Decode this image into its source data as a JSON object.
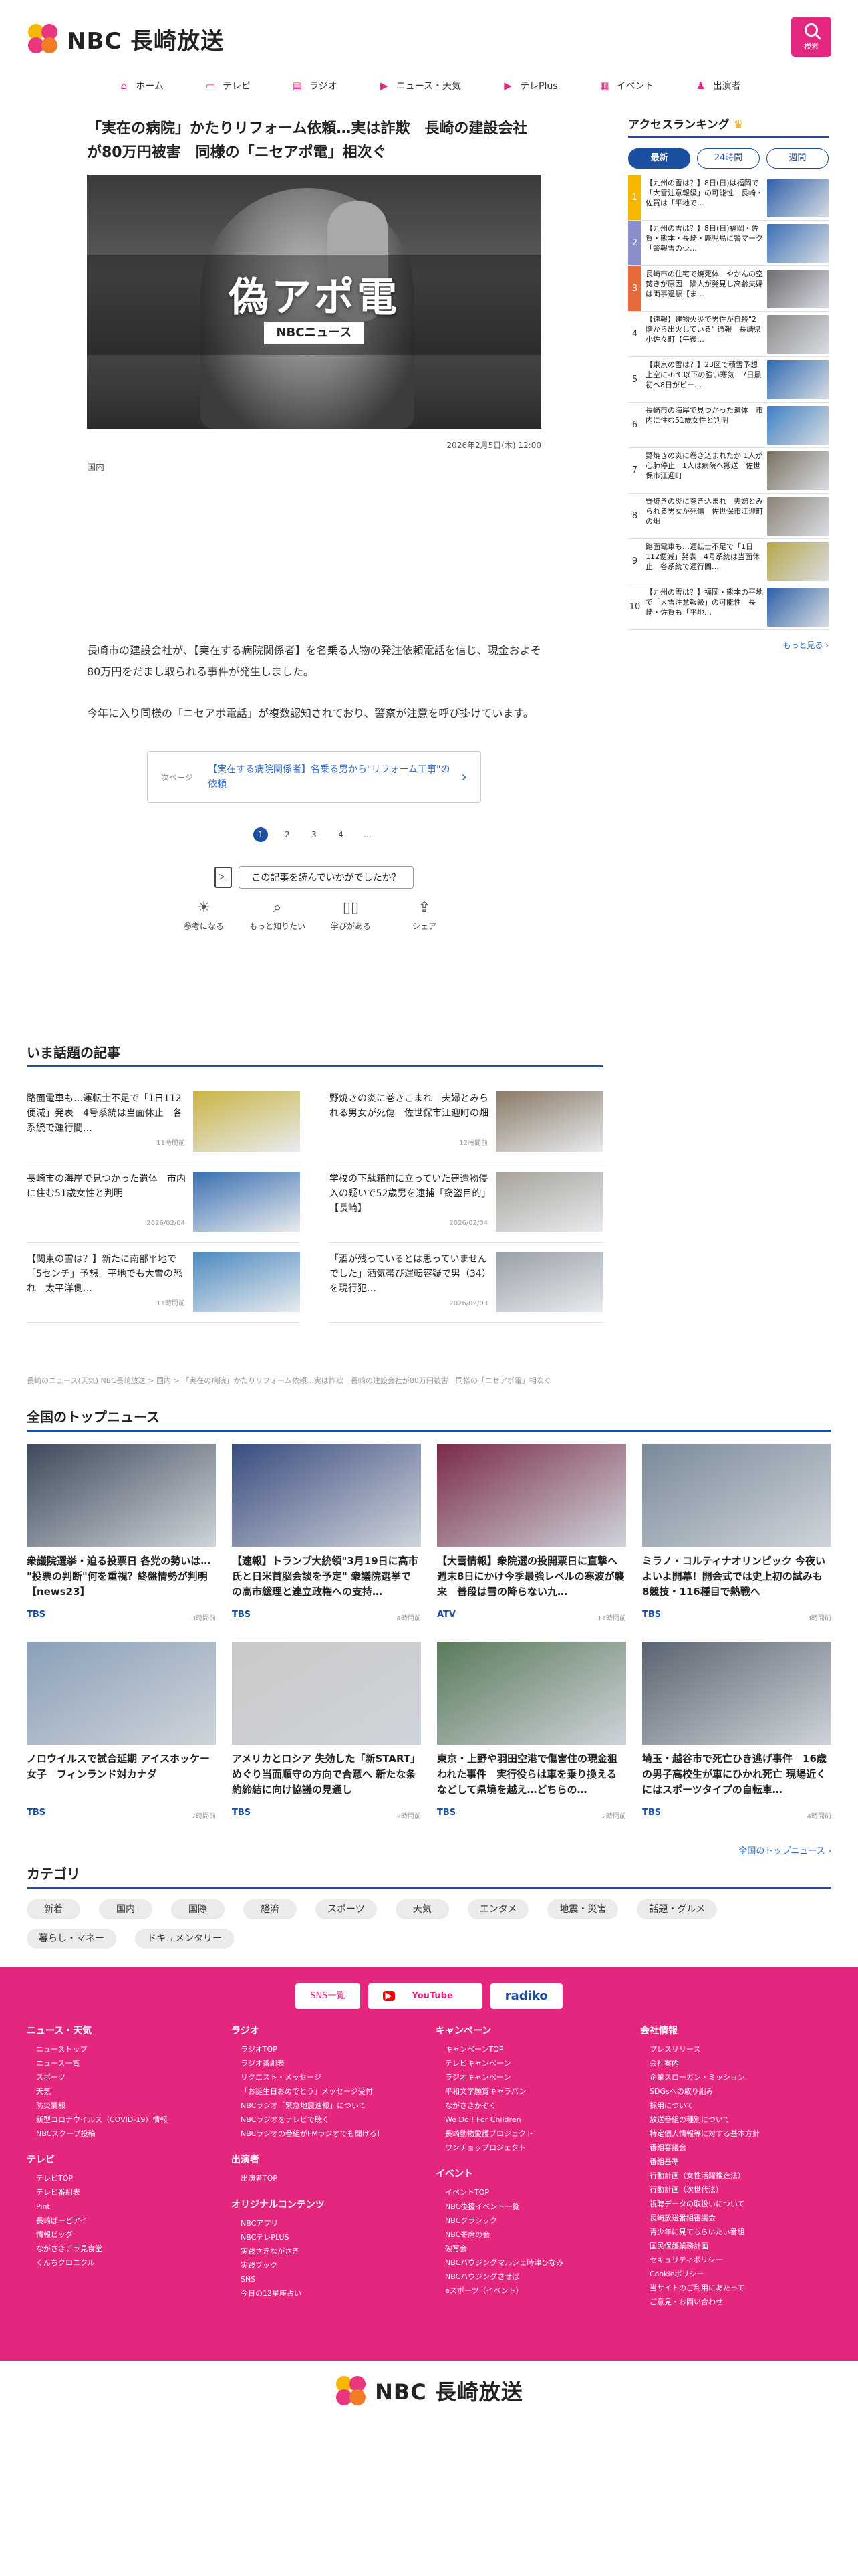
{
  "brand": {
    "logo_text": "NBC 長崎放送"
  },
  "header": {
    "search_label": "検索"
  },
  "nav": [
    {
      "icon": "home-icon",
      "glyph": "⌂",
      "label": "ホーム"
    },
    {
      "icon": "tv-icon",
      "glyph": "▭",
      "label": "テレビ"
    },
    {
      "icon": "radio-icon",
      "glyph": "▤",
      "label": "ラジオ"
    },
    {
      "icon": "news-icon",
      "glyph": "▶",
      "label": "ニュース・天気"
    },
    {
      "icon": "teleplus-icon",
      "glyph": "▶",
      "label": "テレPlus"
    },
    {
      "icon": "calendar-icon",
      "glyph": "▦",
      "label": "イベント"
    },
    {
      "icon": "people-icon",
      "glyph": "♟",
      "label": "出演者"
    }
  ],
  "article": {
    "title": "「実在の病院」かたりリフォーム依頼…実は詐欺　長崎の建設会社が80万円被害　同様の「ニセアポ電」相次ぐ",
    "hero_text": "偽アポ電",
    "hero_tag": "NBCニュース",
    "date": "2026年2月5日(木) 12:00",
    "category": "国内",
    "paragraphs": [
      "長崎市の建設会社が、【実在する病院関係者】を名乗る人物の発注依頼電話を信じ、現金およそ80万円をだまし取られる事件が発生しました。",
      "今年に入り同様の「ニセアポ電話」が複数認知されており、警察が注意を呼び掛けています。"
    ],
    "next_label": "次ページ",
    "next_title": "【実在する病院関係者】名乗る男から\"リフォーム工事\"の依頼",
    "pages": [
      "1",
      "2",
      "3",
      "4",
      "…"
    ],
    "feedback_question": "この記事を読んでいかがでしたか？",
    "feedback_doc": "＞_",
    "feedback_options": [
      {
        "icon": "lightbulb-icon",
        "glyph": "☀",
        "label": "参考になる"
      },
      {
        "icon": "search-icon",
        "glyph": "⌕",
        "label": "もっと知りたい"
      },
      {
        "icon": "book-icon",
        "glyph": "▯▯",
        "label": "学びがある"
      },
      {
        "icon": "share-icon",
        "glyph": "⇪",
        "label": "シェア"
      }
    ]
  },
  "ranking": {
    "title": "アクセスランキング",
    "crown": "♛",
    "tabs": [
      "最新",
      "24時間",
      "週間"
    ],
    "items": [
      {
        "rank": "1",
        "text": "【九州の雪は？】8日(日)は福岡で「大雪注意報級」の可能性　長崎・佐賀は「平地で…",
        "color": "#2d5fa8"
      },
      {
        "rank": "2",
        "text": "【九州の雪は？】8日(日)福岡・佐賀・熊本・長崎・鹿児島に警マーク「警報雪の少…",
        "color": "#3a6fb5"
      },
      {
        "rank": "3",
        "text": "長崎市の住宅で焼死体　やかんの空焚きが原因　隣人が発見し高齢夫婦は両事過懸【ま…",
        "color": "#6b6a70"
      },
      {
        "rank": "4",
        "text": "【速報】建物火災で男性が自殺\"2階から出火している\" 通報　長崎県小佐々町【午後…",
        "color": "#8a8a8a"
      },
      {
        "rank": "5",
        "text": "【東京の雪は？】23区で積雪予想　上空に-6℃以下の強い寒気　7日最初へ8日がピー…",
        "color": "#2f6ab0"
      },
      {
        "rank": "6",
        "text": "長崎市の海岸で見つかった遺体　市内に住む51歳女性と判明",
        "color": "#3f7fc4"
      },
      {
        "rank": "7",
        "text": "野焼きの炎に巻き込まれたか 1人が心肺停止　1人は病院へ搬送　佐世保市江迎町",
        "color": "#7a7060"
      },
      {
        "rank": "8",
        "text": "野焼きの炎に巻き込まれ　夫婦とみられる男女が死傷　佐世保市江迎町の畑",
        "color": "#8b8275"
      },
      {
        "rank": "9",
        "text": "路面電車も…運転士不足で「1日112便減」発表　4号系統は当面休止　各系統で運行間…",
        "color": "#b8a64a"
      },
      {
        "rank": "10",
        "text": "【九州の雪は？】福岡・熊本の平地で「大雪注意報級」の可能性　長崎・佐賀も「平地…",
        "color": "#2d5fa8"
      }
    ],
    "more": "もっと見る ›"
  },
  "topics": {
    "title": "いま話題の記事",
    "items": [
      {
        "title": "路面電車も…運転士不足で「1日112便減」発表　4号系統は当面休止　各系統で運行間…",
        "time": "11時間前",
        "color": "#c9b545"
      },
      {
        "title": "野焼きの炎に巻きこまれ　夫婦とみられる男女が死傷　佐世保市江迎町の畑",
        "time": "12時間前",
        "color": "#8a7a66"
      },
      {
        "title": "長崎市の海岸で見つかった遺体　市内に住む51歳女性と判明",
        "time": "2026/02/04",
        "color": "#3a6fb0"
      },
      {
        "title": "学校の下駄箱前に立っていた建造物侵入の疑いで52歳男を逮捕「窃盗目的」【長崎】",
        "time": "2026/02/04",
        "color": "#a7a39b"
      },
      {
        "title": "【関東の雪は？】新たに南部平地で「5センチ」予想　平地でも大雪の恐れ　太平洋側…",
        "time": "11時間前",
        "color": "#4d8ac0"
      },
      {
        "title": "「酒が残っているとは思っていませんでした」酒気帯び運転容疑で男（34）を現行犯…",
        "time": "2026/02/03",
        "color": "#9aa0a8"
      }
    ]
  },
  "breadcrumb": "長崎のニュース(天気) NBC長崎放送 > 国内 > 「実在の病院」かたりリフォーム依頼…実は詐欺　長崎の建設会社が80万円被害　同様の「ニセアポ電」相次ぐ",
  "national": {
    "title": "全国のトップニュース",
    "items": [
      {
        "title": "衆議院選挙・迫る投票日 各党の勢いは… \"投票の判断\"何を重視？終盤情勢が判明【news23】",
        "source": "TBS",
        "time": "3時間前",
        "color": "#3d4a5a"
      },
      {
        "title": "【速報】トランプ大統領\"3月19日に高市氏と日米首脳会談を予定\" 衆議院選挙での高市総理と連立政権への支持…",
        "source": "TBS",
        "time": "4時間前",
        "color": "#3a4c80"
      },
      {
        "title": "【大雪情報】衆院選の投開票日に直撃へ　週末8日にかけ今季最強レベルの寒波が襲来　普段は雪の降らない九…",
        "source": "ATV",
        "time": "11時間前",
        "color": "#7a2a4a"
      },
      {
        "title": "ミラノ・コルティナオリンピック 今夜いよいよ開幕！開会式では史上初の試みも　8競技・116種目で熱戦へ",
        "source": "TBS",
        "time": "3時間前",
        "color": "#7a8a9a"
      },
      {
        "title": "ノロウイルスで試合延期 アイスホッケー女子　フィンランド対カナダ",
        "source": "TBS",
        "time": "7時間前",
        "color": "#8aa0b8"
      },
      {
        "title": "アメリカとロシア 失効した「新START」めぐり当面順守の方向で合意へ 新たな条約締結に向け協議の見通し",
        "source": "TBS",
        "time": "2時間前",
        "color": "#c9c9c9"
      },
      {
        "title": "東京・上野や羽田空港で傷害住の現金狙われた事件　実行役らは車を乗り換えるなどして県境を越え…どちらの…",
        "source": "TBS",
        "time": "2時間前",
        "color": "#5a7a5a"
      },
      {
        "title": "埼玉・越谷市で死亡ひき逃げ事件　16歳の男子高校生が車にひかれ死亡 現場近くにはスポーツタイプの自転車…",
        "source": "TBS",
        "time": "4時間前",
        "color": "#5a6470"
      }
    ],
    "more": "全国のトップニュース ›"
  },
  "categories": {
    "title": "カテゴリ",
    "items": [
      "新着",
      "国内",
      "国際",
      "経済",
      "スポーツ",
      "天気",
      "エンタメ",
      "地震・災害",
      "話題・グルメ",
      "暮らし・マネー",
      "ドキュメンタリー"
    ]
  },
  "footer": {
    "sns_label": "SNS一覧",
    "youtube_label": "YouTube",
    "radiko_label": "radiko",
    "columns": [
      [
        {
          "heading": "ニュース・天気",
          "links": [
            "ニューストップ",
            "ニュース一覧",
            "スポーツ",
            "天気",
            "防災情報",
            "新型コロナウイルス（COVID-19）情報",
            "NBCスクープ投稿"
          ]
        },
        {
          "heading": "テレビ",
          "links": [
            "テレビTOP",
            "テレビ番組表",
            "Pint",
            "長崎ばーどアイ",
            "情報ビッグ",
            "ながさきチラ見食堂",
            "くんちクロニクル"
          ]
        }
      ],
      [
        {
          "heading": "ラジオ",
          "links": [
            "ラジオTOP",
            "ラジオ番組表",
            "リクエスト・メッセージ",
            "「お誕生日おめでとう」メッセージ受付",
            "NBCラジオ「緊急地震速報」について",
            "NBCラジオをテレビで聴く",
            "NBCラジオの番組がFMラジオでも聞ける！"
          ]
        },
        {
          "heading": "出演者",
          "links": [
            "出演者TOP"
          ]
        },
        {
          "heading": "オリジナルコンテンツ",
          "links": [
            "NBCアプリ",
            "NBCテレPLUS",
            "実践さきながさき",
            "実践ブック",
            "SNS",
            "今日の12星座占い"
          ]
        }
      ],
      [
        {
          "heading": "キャンペーン",
          "links": [
            "キャンペーンTOP",
            "テレビキャンペーン",
            "ラジオキャンペーン",
            "平和文学願賞キャラバン",
            "ながさきかぞく",
            "We Do ! For Children",
            "長崎動物愛護プロジェクト",
            "ワンチョップロジェクト"
          ]
        },
        {
          "heading": "イベント",
          "links": [
            "イベントTOP",
            "NBC後援イベント一覧",
            "NBCクラシック",
            "NBC寄席の会",
            "破写会",
            "NBCハウジングマルシェ時津ひなみ",
            "NBCハウジングさせば",
            "eスポーツ（イベント）"
          ]
        }
      ],
      [
        {
          "heading": "会社情報",
          "links": [
            "プレスリリース",
            "会社案内",
            "企業スローガン・ミッション",
            "SDGsへの取り組み",
            "採用について",
            "放送番組の種別について",
            "特定個人情報等に対する基本方針",
            "番組審議会",
            "番組基準",
            "行動計画（女性活躍推進法）",
            "行動計画（次世代法）",
            "視聴データの取扱いについて",
            "長崎放送番組審議会",
            "青少年に見てもらいたい番組",
            "国民保護業務計画",
            "セキュリティポリシー",
            "Cookieポリシー",
            "当サイトのご利用にあたって",
            "ご意見・お問い合わせ"
          ]
        }
      ]
    ]
  },
  "colors": {
    "brand_pink": "#e4267e",
    "accent_blue": "#1b4fa0",
    "link_blue": "#2a67c9"
  }
}
